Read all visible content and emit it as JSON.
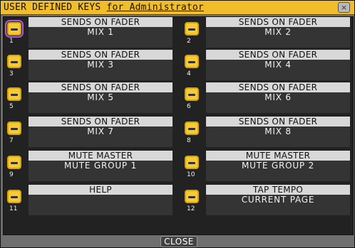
{
  "window": {
    "title": "USER DEFINED KEYS",
    "owner": "for Administrator",
    "close_x": "×",
    "close_button": "CLOSE"
  },
  "keys": [
    {
      "num": "1",
      "function": "SENDS ON FADER",
      "parameter": "MIX 1"
    },
    {
      "num": "2",
      "function": "SENDS ON FADER",
      "parameter": "MIX 2"
    },
    {
      "num": "3",
      "function": "SENDS ON FADER",
      "parameter": "MIX 3"
    },
    {
      "num": "4",
      "function": "SENDS ON FADER",
      "parameter": "MIX 4"
    },
    {
      "num": "5",
      "function": "SENDS ON FADER",
      "parameter": "MIX 5"
    },
    {
      "num": "6",
      "function": "SENDS ON FADER",
      "parameter": "MIX 6"
    },
    {
      "num": "7",
      "function": "SENDS ON FADER",
      "parameter": "MIX 7"
    },
    {
      "num": "8",
      "function": "SENDS ON FADER",
      "parameter": "MIX 8"
    },
    {
      "num": "9",
      "function": "MUTE MASTER",
      "parameter": "MUTE GROUP 1"
    },
    {
      "num": "10",
      "function": "MUTE MASTER",
      "parameter": "MUTE GROUP 2"
    },
    {
      "num": "11",
      "function": "HELP",
      "parameter": ""
    },
    {
      "num": "12",
      "function": "TAP TEMPO",
      "parameter": "CURRENT PAGE"
    }
  ],
  "colors": {
    "title_bar": "#f2bd2a",
    "key_icon": "#f6c938",
    "selected_outline": "#b35bd8",
    "background": "#222222"
  }
}
